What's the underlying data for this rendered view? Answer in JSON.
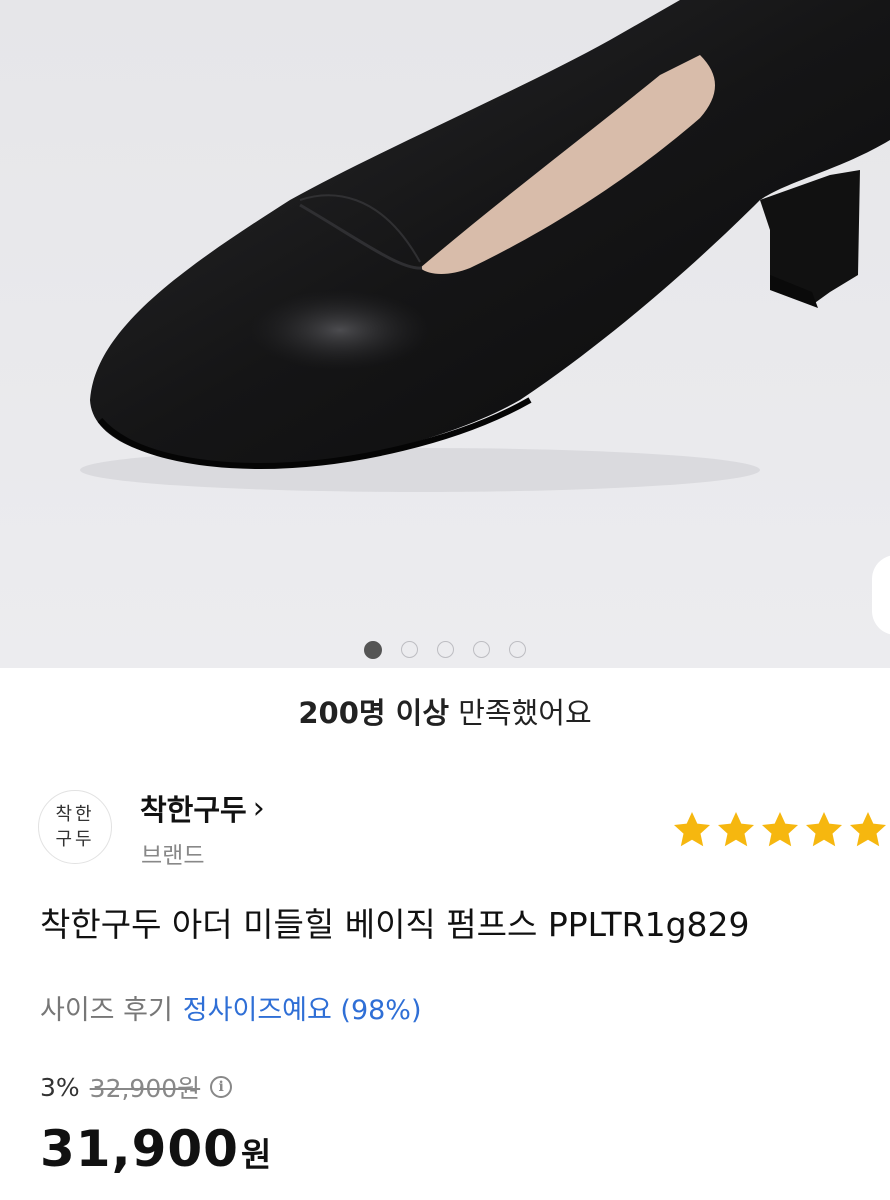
{
  "carousel": {
    "total": 5,
    "active": 0
  },
  "satisfaction": {
    "bold": "200명 이상",
    "rest": "만족했어요"
  },
  "brand": {
    "logo_line1": "착한",
    "logo_line2": "구두",
    "name": "착한구두",
    "chevron": "›",
    "subtitle": "브랜드"
  },
  "rating": {
    "stars": 5,
    "color": "#f6b70f"
  },
  "product": {
    "title": "착한구두 아더 미들힐 베이직 펌프스 PPLTR1g829"
  },
  "size_review": {
    "label": "사이즈 후기",
    "value": "정사이즈예요 (98%)",
    "accent": "#2f6fd6"
  },
  "price": {
    "discount": "3%",
    "original": "32,900원",
    "info_icon": "i",
    "sale_number": "31,900",
    "sale_unit": "원"
  }
}
